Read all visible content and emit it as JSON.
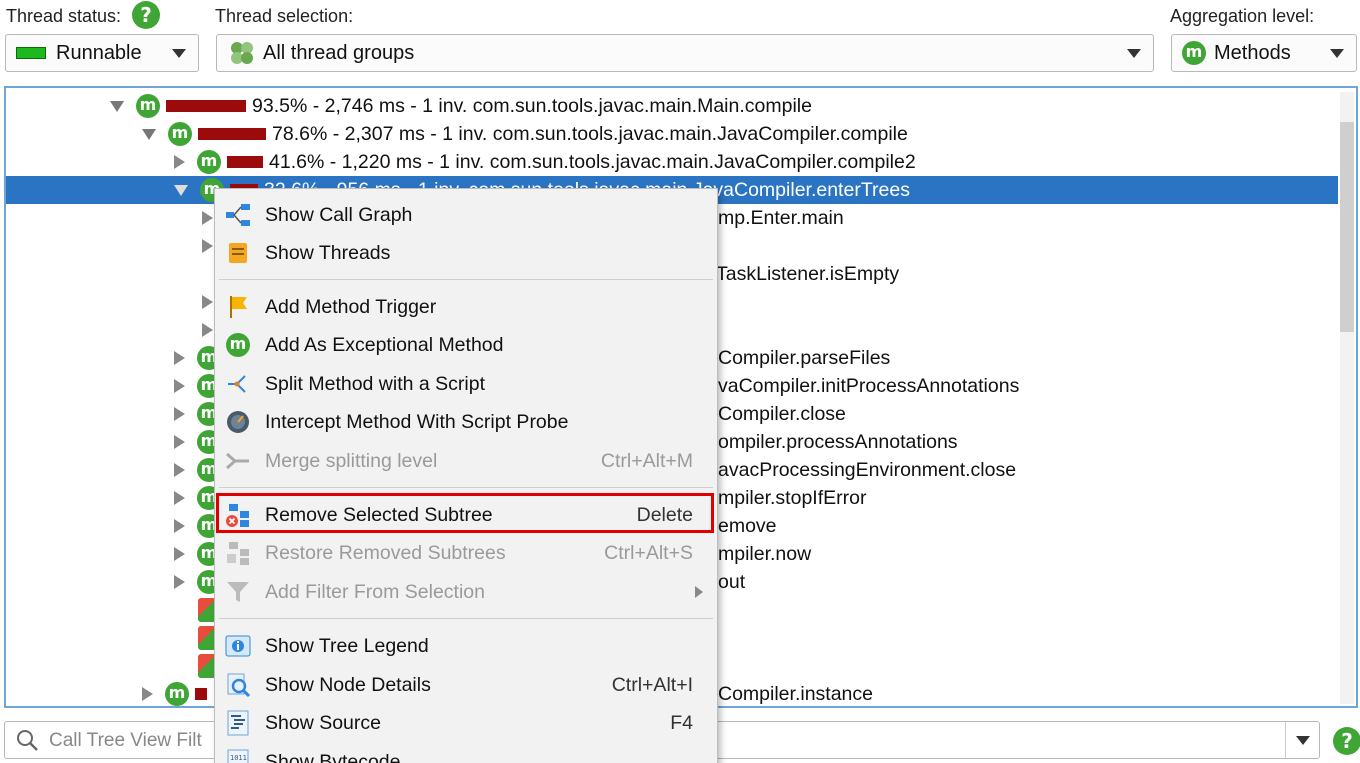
{
  "header": {
    "thread_status_label": "Thread status:",
    "thread_status_value": "Runnable",
    "thread_selection_label": "Thread selection:",
    "thread_selection_value": "All thread groups",
    "aggregation_label": "Aggregation level:",
    "aggregation_value": "Methods",
    "help_glyph": "?"
  },
  "tree": {
    "badge_letter": "m",
    "rows": [
      {
        "text": "93.5% - 2,746 ms - 1 inv. com.sun.tools.javac.main.Main.compile",
        "percent": 93.5
      },
      {
        "text": "78.6% - 2,307 ms - 1 inv. com.sun.tools.javac.main.JavaCompiler.compile",
        "percent": 78.6
      },
      {
        "text": "41.6% - 1,220 ms - 1 inv. com.sun.tools.javac.main.JavaCompiler.compile2",
        "percent": 41.6
      },
      {
        "text": "32.6% - 956 ms - 1 inv. com.sun.tools.javac.main.JavaCompiler.enterTrees",
        "percent": 32.6,
        "selected": true
      }
    ],
    "partial_rows": [
      "mp.Enter.main",
      "TaskListener.isEmpty",
      "Compiler.parseFiles",
      "vaCompiler.initProcessAnnotations",
      "Compiler.close",
      "ompiler.processAnnotations",
      "avacProcessingEnvironment.close",
      "mpiler.stopIfError",
      "emove",
      "mpiler.now",
      "out",
      "Compiler.instance"
    ]
  },
  "context_menu": {
    "items": [
      {
        "label": "Show Call Graph",
        "shortcut": "",
        "icon": "call-graph-icon",
        "enabled": true
      },
      {
        "label": "Show Threads",
        "shortcut": "",
        "icon": "threads-icon",
        "enabled": true
      },
      {
        "label": "Add Method Trigger",
        "shortcut": "",
        "icon": "flag-icon",
        "enabled": true
      },
      {
        "label": "Add As Exceptional Method",
        "shortcut": "",
        "icon": "exceptional-method-icon",
        "enabled": true
      },
      {
        "label": "Split Method with a Script",
        "shortcut": "",
        "icon": "split-icon",
        "enabled": true
      },
      {
        "label": "Intercept Method With Script Probe",
        "shortcut": "",
        "icon": "probe-icon",
        "enabled": true
      },
      {
        "label": "Merge splitting level",
        "shortcut": "Ctrl+Alt+M",
        "icon": "merge-icon",
        "enabled": false
      },
      {
        "label": "Remove Selected Subtree",
        "shortcut": "Delete",
        "icon": "remove-subtree-icon",
        "enabled": true,
        "highlighted": true
      },
      {
        "label": "Restore Removed Subtrees",
        "shortcut": "Ctrl+Alt+S",
        "icon": "restore-subtree-icon",
        "enabled": false
      },
      {
        "label": "Add Filter From Selection",
        "shortcut": "",
        "icon": "filter-icon",
        "enabled": false,
        "submenu": true
      },
      {
        "label": "Show Tree Legend",
        "shortcut": "",
        "icon": "legend-icon",
        "enabled": true
      },
      {
        "label": "Show Node Details",
        "shortcut": "Ctrl+Alt+I",
        "icon": "node-details-icon",
        "enabled": true
      },
      {
        "label": "Show Source",
        "shortcut": "F4",
        "icon": "source-icon",
        "enabled": true
      },
      {
        "label": "Show Bytecode",
        "shortcut": "",
        "icon": "bytecode-icon",
        "enabled": true
      }
    ]
  },
  "filter": {
    "placeholder": "Call Tree View Filt"
  },
  "colors": {
    "accent_green": "#3fa535",
    "selection_blue": "#2b74c4",
    "bar_red": "#9b0b0b",
    "highlight_red": "#e00000"
  }
}
